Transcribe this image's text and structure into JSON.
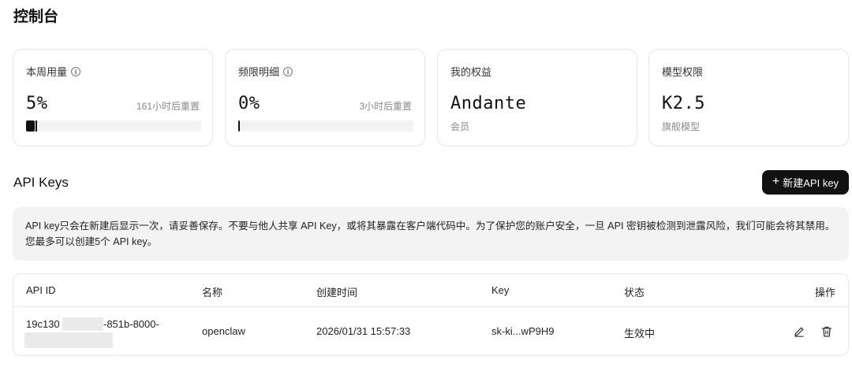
{
  "page": {
    "title": "控制台"
  },
  "cards": [
    {
      "label": "本周用量",
      "value": "5%",
      "reset": "161小时后重置",
      "progress": 0.05,
      "info_icon": "info-icon"
    },
    {
      "label": "频限明细",
      "value": "0%",
      "reset": "3小时后重置",
      "progress": 0.0,
      "info_icon": "info-icon"
    },
    {
      "label": "我的权益",
      "value": "Andante",
      "sub": "会员"
    },
    {
      "label": "模型权限",
      "value": "K2.5",
      "sub": "旗舰模型"
    }
  ],
  "api_keys": {
    "title": "API Keys",
    "new_button": {
      "icon": "+",
      "label": "新建API key"
    },
    "notice": "API key只会在新建后显示一次，请妥善保存。不要与他人共享 API Key，或将其暴露在客户端代码中。为了保护您的账户安全，一旦 API 密钥被检测到泄露风险，我们可能会将其禁用。您最多可以创建5个 API key。",
    "columns": [
      "API ID",
      "名称",
      "创建时间",
      "Key",
      "状态",
      "操作"
    ],
    "rows": [
      {
        "api_id_start": "19c130",
        "api_id_middle": "-851b-8000-",
        "name": "openclaw",
        "created": "2026/01/31 15:57:33",
        "key": "sk-ki...wP9H9",
        "status": "生效中",
        "actions": [
          "edit-icon",
          "trash-icon"
        ]
      }
    ]
  }
}
